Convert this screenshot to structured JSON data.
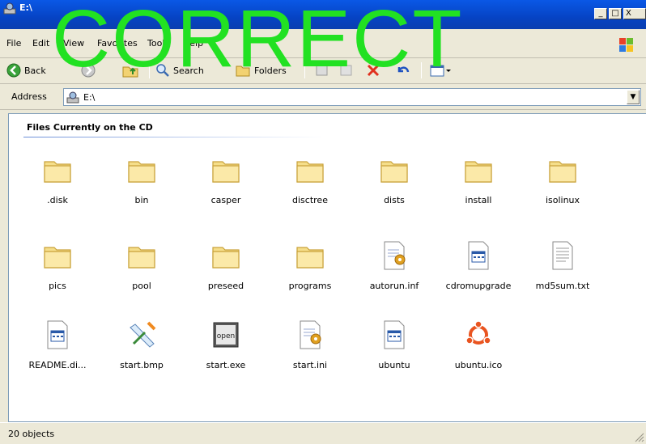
{
  "window": {
    "title": "E:\\"
  },
  "overlay_text": "CORRECT",
  "caption_buttons": {
    "minimize": "_",
    "maximize": "□",
    "close": "X"
  },
  "menu": [
    "File",
    "Edit",
    "View",
    "Favorites",
    "Tools",
    "Help"
  ],
  "toolbar": {
    "back": "Back",
    "search": "Search",
    "folders": "Folders"
  },
  "address": {
    "label": "Address",
    "value": "E:\\"
  },
  "group": {
    "header": "Files Currently on the CD"
  },
  "files": [
    {
      "name": ".disk",
      "type": "folder"
    },
    {
      "name": "bin",
      "type": "folder"
    },
    {
      "name": "casper",
      "type": "folder"
    },
    {
      "name": "disctree",
      "type": "folder"
    },
    {
      "name": "dists",
      "type": "folder"
    },
    {
      "name": "install",
      "type": "folder"
    },
    {
      "name": "isolinux",
      "type": "folder"
    },
    {
      "name": "pics",
      "type": "folder"
    },
    {
      "name": "pool",
      "type": "folder"
    },
    {
      "name": "preseed",
      "type": "folder"
    },
    {
      "name": "programs",
      "type": "folder"
    },
    {
      "name": "autorun.inf",
      "type": "config-file"
    },
    {
      "name": "cdromupgrade",
      "type": "window-file"
    },
    {
      "name": "md5sum.txt",
      "type": "text-file"
    },
    {
      "name": "README.di...",
      "type": "window-file"
    },
    {
      "name": "start.bmp",
      "type": "bitmap-file"
    },
    {
      "name": "start.exe",
      "type": "exe-file"
    },
    {
      "name": "start.ini",
      "type": "config-file"
    },
    {
      "name": "ubuntu",
      "type": "window-file"
    },
    {
      "name": "ubuntu.ico",
      "type": "ubuntu-logo"
    }
  ],
  "status": {
    "text": "20 objects"
  }
}
